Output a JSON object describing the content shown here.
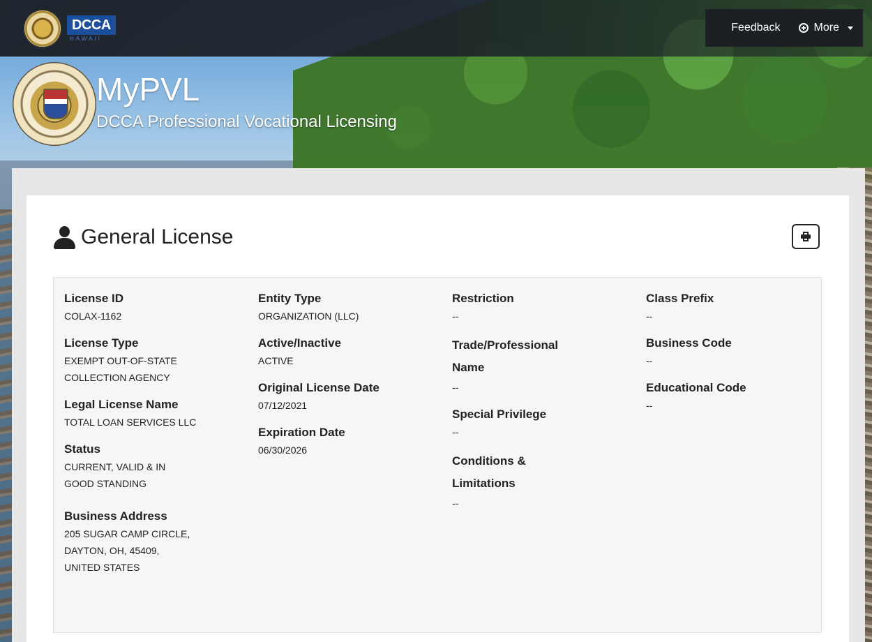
{
  "nav": {
    "logo_text": "DCCA",
    "logo_subtext": "HAWAII",
    "feedback_label": "Feedback",
    "more_label": "More"
  },
  "header": {
    "title": "MyPVL",
    "subtitle": "DCCA Professional Vocational Licensing"
  },
  "page": {
    "title": "General License"
  },
  "details": {
    "columns": [
      [
        {
          "label": "License ID",
          "value": "COLAX-1162"
        },
        {
          "label": "License Type",
          "value": "EXEMPT OUT-OF-STATE\nCOLLECTION AGENCY"
        },
        {
          "label": "Legal License Name",
          "value": "TOTAL LOAN SERVICES LLC"
        },
        {
          "label": "Status",
          "value": "CURRENT, VALID & IN\nGOOD STANDING"
        },
        {
          "label": "Business Address",
          "value": "205 SUGAR CAMP CIRCLE,\nDAYTON, OH, 45409,\nUNITED STATES"
        }
      ],
      [
        {
          "label": "Entity Type",
          "value": "ORGANIZATION (LLC)"
        },
        {
          "label": "Active/Inactive",
          "value": "ACTIVE"
        },
        {
          "label": "Original License Date",
          "value": "07/12/2021"
        },
        {
          "label": "Expiration Date",
          "value": "06/30/2026"
        }
      ],
      [
        {
          "label": "Restriction",
          "value": "--"
        },
        {
          "label": "Trade/Professional\nName",
          "value": "--"
        },
        {
          "label": "Special Privilege",
          "value": "--"
        },
        {
          "label": "Conditions &\nLimitations",
          "value": "--"
        }
      ],
      [
        {
          "label": "Class Prefix",
          "value": "--"
        },
        {
          "label": "Business Code",
          "value": "--"
        },
        {
          "label": "Educational Code",
          "value": "--"
        }
      ]
    ]
  }
}
